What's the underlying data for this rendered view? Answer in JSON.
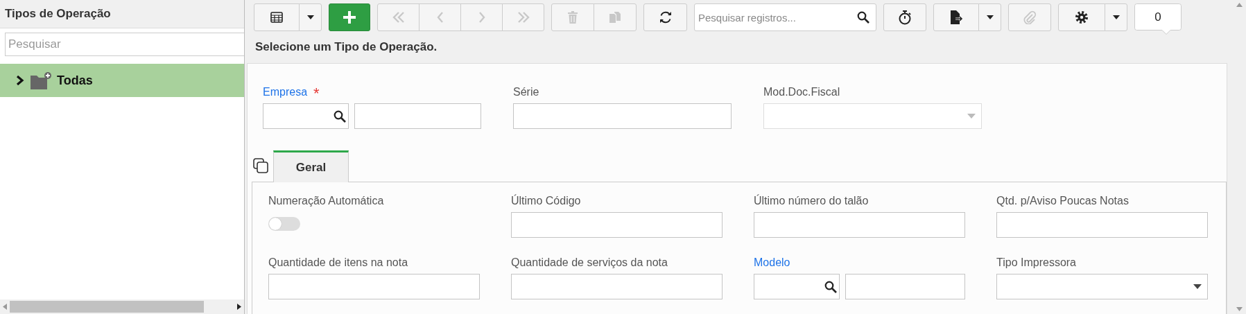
{
  "sidebar": {
    "title": "Tipos de Operação",
    "search": {
      "placeholder": "Pesquisar"
    },
    "tree": [
      {
        "label": "Todas",
        "expanded": false,
        "selected": true
      }
    ]
  },
  "toolbar": {
    "groups": [
      {
        "items": [
          {
            "kind": "table",
            "disabled": false
          },
          {
            "kind": "dropdown",
            "disabled": false
          }
        ]
      },
      {
        "items": [
          {
            "kind": "add",
            "disabled": false
          }
        ]
      },
      {
        "items": [
          {
            "kind": "first",
            "disabled": true
          },
          {
            "kind": "previous",
            "disabled": true
          },
          {
            "kind": "next",
            "disabled": true
          },
          {
            "kind": "last",
            "disabled": true
          }
        ]
      },
      {
        "items": [
          {
            "kind": "delete",
            "disabled": true
          },
          {
            "kind": "duplicate",
            "disabled": true
          }
        ]
      },
      {
        "items": [
          {
            "kind": "refresh",
            "disabled": false
          }
        ]
      },
      {
        "items": [
          {
            "kind": "search",
            "disabled": false,
            "placeholder": "Pesquisar registros..."
          }
        ]
      },
      {
        "items": [
          {
            "kind": "timer",
            "disabled": false
          }
        ]
      },
      {
        "items": [
          {
            "kind": "export",
            "disabled": false
          },
          {
            "kind": "dropdown",
            "disabled": false
          }
        ]
      },
      {
        "items": [
          {
            "kind": "attach",
            "disabled": true
          }
        ]
      },
      {
        "items": [
          {
            "kind": "settings",
            "disabled": false
          },
          {
            "kind": "dropdown",
            "disabled": false
          }
        ]
      },
      {
        "items": [
          {
            "kind": "counter",
            "disabled": false,
            "text": "0"
          }
        ]
      }
    ]
  },
  "heading": "Selecione um Tipo de Operação.",
  "form": {
    "fields": [
      {
        "label": "Empresa",
        "kind": "lookup",
        "link": true,
        "required_mark": "*",
        "disabled": false
      },
      {
        "label": "Série",
        "kind": "text",
        "link": false,
        "disabled": false
      },
      {
        "label": "Mod.Doc.Fiscal",
        "kind": "select",
        "link": false,
        "disabled": true
      }
    ],
    "tabs": [
      {
        "label": "Geral",
        "selected": true
      }
    ],
    "tab_fields": [
      {
        "label": "Numeração Automática",
        "kind": "toggle",
        "link": false,
        "on": false
      },
      {
        "label": "Último Código",
        "kind": "text",
        "link": false
      },
      {
        "label": "Último número do talão",
        "kind": "text",
        "link": false
      },
      {
        "label": "Qtd. p/Aviso Poucas Notas",
        "kind": "text",
        "link": false
      },
      {
        "label": "Quantidade de itens na nota",
        "kind": "text",
        "link": false
      },
      {
        "label": "Quantidade de serviços da nota",
        "kind": "text",
        "link": false
      },
      {
        "label": "Modelo",
        "kind": "lookup",
        "link": true
      },
      {
        "label": "Tipo Impressora",
        "kind": "select",
        "link": false
      }
    ]
  }
}
